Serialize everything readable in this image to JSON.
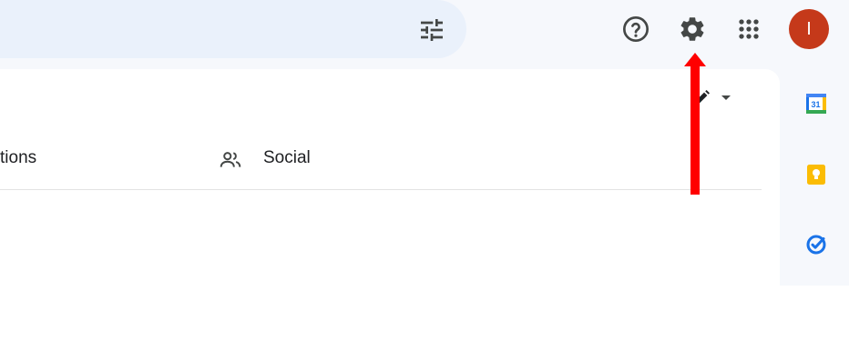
{
  "header": {
    "search_filter_icon": "tune-icon",
    "help_icon": "help-icon",
    "settings_icon": "gear-icon",
    "apps_icon": "apps-grid-icon",
    "avatar_letter": "I",
    "avatar_color": "#c5391a"
  },
  "toolbar": {
    "edit_icon": "pencil-icon",
    "dropdown_icon": "caret-down-icon"
  },
  "tabs": [
    {
      "label": "tions",
      "icon": "tag-icon"
    },
    {
      "label": "Social",
      "icon": "people-icon"
    }
  ],
  "side_panel": {
    "items": [
      {
        "name": "calendar",
        "text": "31",
        "color": "#1a73e8"
      },
      {
        "name": "keep",
        "color": "#fbbc04"
      },
      {
        "name": "tasks",
        "color": "#1a73e8"
      }
    ]
  },
  "annotation": {
    "arrow_color": "#ff0000"
  }
}
